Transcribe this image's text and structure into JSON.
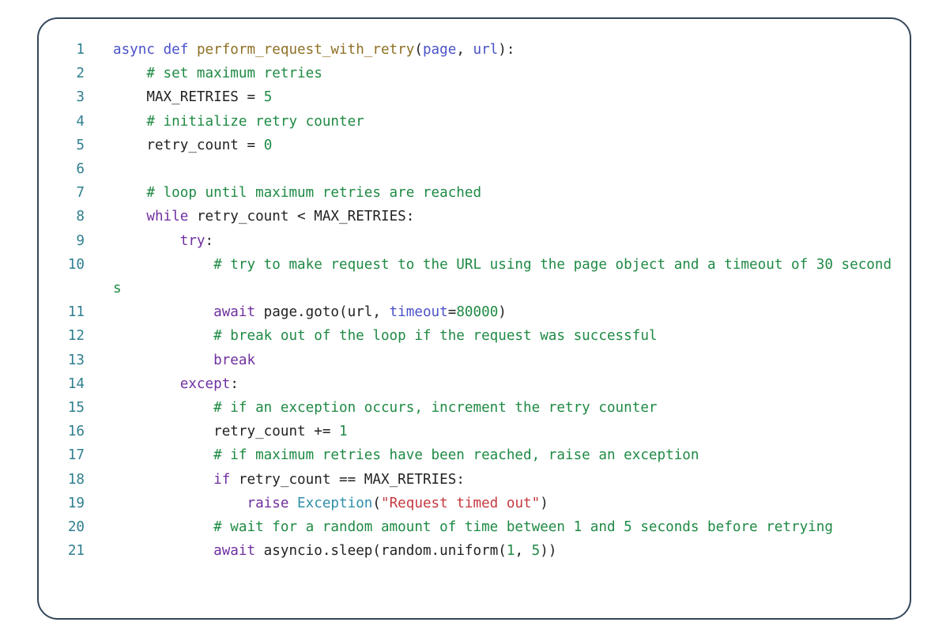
{
  "card": {
    "border_color": "#33475b",
    "background": "#ffffff",
    "gutter_color": "#2f7f8f"
  },
  "palette": {
    "keyword": "#7030a0",
    "keyword_def": "#4a52c8",
    "function_name": "#8f7026",
    "parameter": "#4a52c8",
    "comment": "#1f8a44",
    "number": "#1f8a44",
    "string": "#c5393f",
    "class_name": "#2f8fa8",
    "plain": "#222222"
  },
  "code": {
    "language": "python",
    "lines": [
      {
        "number": "1",
        "text": "async def perform_request_with_retry(page, url):"
      },
      {
        "number": "2",
        "text": "    # set maximum retries"
      },
      {
        "number": "3",
        "text": "    MAX_RETRIES = 5"
      },
      {
        "number": "4",
        "text": "    # initialize retry counter"
      },
      {
        "number": "5",
        "text": "    retry_count = 0"
      },
      {
        "number": "6",
        "text": ""
      },
      {
        "number": "7",
        "text": "    # loop until maximum retries are reached"
      },
      {
        "number": "8",
        "text": "    while retry_count < MAX_RETRIES:"
      },
      {
        "number": "9",
        "text": "        try:"
      },
      {
        "number": "10",
        "text": "            # try to make request to the URL using the page object and a timeout of 30 seconds"
      },
      {
        "number": "11",
        "text": "            await page.goto(url, timeout=80000)"
      },
      {
        "number": "12",
        "text": "            # break out of the loop if the request was successful"
      },
      {
        "number": "13",
        "text": "            break"
      },
      {
        "number": "14",
        "text": "        except:"
      },
      {
        "number": "15",
        "text": "            # if an exception occurs, increment the retry counter"
      },
      {
        "number": "16",
        "text": "            retry_count += 1"
      },
      {
        "number": "17",
        "text": "            # if maximum retries have been reached, raise an exception"
      },
      {
        "number": "18",
        "text": "            if retry_count == MAX_RETRIES:"
      },
      {
        "number": "19",
        "text": "                raise Exception(\"Request timed out\")"
      },
      {
        "number": "20",
        "text": "            # wait for a random amount of time between 1 and 5 seconds before retrying"
      },
      {
        "number": "21",
        "text": "            await asyncio.sleep(random.uniform(1, 5))"
      }
    ]
  }
}
